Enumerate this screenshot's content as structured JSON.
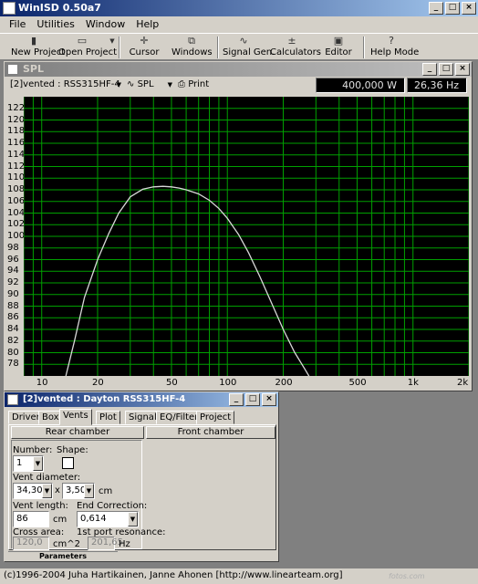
{
  "app": {
    "title": "WinISD 0.50a7",
    "status": "(c)1996-2004 Juha Hartikainen, Janne Ahonen [http://www.linearteam.org]"
  },
  "menu": [
    "File",
    "Utilities",
    "Window",
    "Help"
  ],
  "toolbar": {
    "new_project": "New Project",
    "open_project": "Open Project",
    "cursor": "Cursor",
    "windows": "Windows",
    "signal_gen": "Signal Gen.",
    "calculators": "Calculators",
    "editor": "Editor",
    "help_mode": "Help Mode"
  },
  "spl_window": {
    "title": "SPL",
    "project_select": "[2]vented : RSS315HF-4",
    "curve_select": "SPL",
    "print": "Print",
    "power_readout": "400,000 W",
    "freq_readout": "26,36 Hz"
  },
  "chart_data": {
    "type": "line",
    "title": "",
    "xlabel": "",
    "ylabel": "",
    "x_scale": "log",
    "xlim": [
      8,
      2000
    ],
    "ylim": [
      76,
      124
    ],
    "grid": true,
    "y_ticks": [
      78,
      80,
      82,
      84,
      86,
      88,
      90,
      92,
      94,
      96,
      98,
      100,
      102,
      104,
      106,
      108,
      110,
      112,
      114,
      116,
      118,
      120,
      122
    ],
    "x_ticks": [
      {
        "value": 10,
        "label": "10"
      },
      {
        "value": 20,
        "label": "20"
      },
      {
        "value": 50,
        "label": "50"
      },
      {
        "value": 100,
        "label": "100"
      },
      {
        "value": 200,
        "label": "200"
      },
      {
        "value": 500,
        "label": "500"
      },
      {
        "value": 1000,
        "label": "1k"
      },
      {
        "value": 2000,
        "label": "2k"
      }
    ],
    "series": [
      {
        "color": "#d8d8d8",
        "x": [
          13.5,
          15,
          17,
          20,
          23,
          26,
          30,
          35,
          40,
          45,
          50,
          55,
          60,
          70,
          80,
          90,
          100,
          115,
          130,
          150,
          170,
          200,
          230,
          260,
          300
        ],
        "y": [
          76,
          82,
          89.5,
          96,
          100.5,
          104,
          106.8,
          108.1,
          108.5,
          108.6,
          108.5,
          108.3,
          108.0,
          107.3,
          106.2,
          104.8,
          103.1,
          100.3,
          97.2,
          93.0,
          89.1,
          84.0,
          80.1,
          77.3,
          74
        ]
      }
    ]
  },
  "params_window": {
    "title": "[2]vented : Dayton RSS315HF-4",
    "tabs": [
      "Driver",
      "Box",
      "Vents",
      "Plot",
      "Signal",
      "EQ/Filter",
      "Project"
    ],
    "active_tab": "Vents",
    "rear_chamber": "Rear chamber",
    "front_chamber": "Front chamber",
    "number_label": "Number:",
    "number_value": "1",
    "shape_label": "Shape:",
    "vent_diameter_label": "Vent diameter:",
    "diameter_1": "34,30",
    "times": "x",
    "diameter_2": "3,50",
    "cm_1": "cm",
    "vent_length_label": "Vent length:",
    "vent_length_value": "86",
    "cm_2": "cm",
    "end_correction_label": "End Correction:",
    "end_correction_value": "0,614",
    "cross_area_label": "Cross area:",
    "cross_area_value": "120,0",
    "cm2": "cm^2",
    "port_res_label": "1st port resonance:",
    "port_res_value": "201,65",
    "hz": "Hz",
    "footer_tab": "Parameters"
  },
  "watermark": "fotos.com"
}
